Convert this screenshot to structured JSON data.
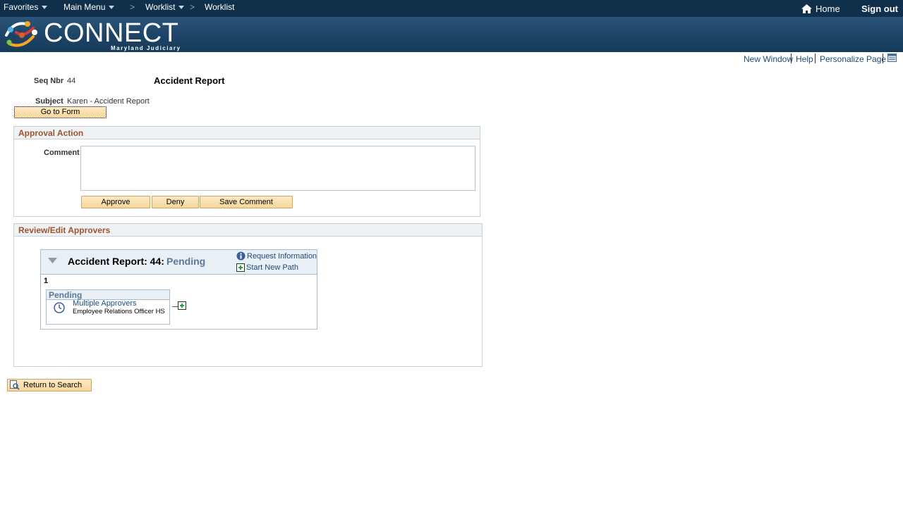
{
  "topnav": {
    "favorites": "Favorites",
    "main_menu": "Main Menu",
    "worklist_menu": "Worklist",
    "worklist_crumb": "Worklist",
    "sep": ">",
    "home": "Home",
    "sign_out": "Sign out"
  },
  "banner": {
    "logo_text": "CONNECT",
    "logo_sub": "Maryland Judiciary"
  },
  "page_links": {
    "new_window": "New Window",
    "help": "Help",
    "personalize": "Personalize Page"
  },
  "record": {
    "seq_label": "Seq Nbr",
    "seq_value": "44",
    "title": "Accident Report",
    "subject_label": "Subject",
    "subject_value": "Karen - Accident Report",
    "go_to_form": "Go to Form"
  },
  "approval": {
    "header": "Approval Action",
    "comment_label": "Comment",
    "comment_value": "",
    "approve": "Approve",
    "deny": "Deny",
    "save_comment": "Save Comment"
  },
  "review": {
    "header": "Review/Edit Approvers",
    "map_title": "Accident Report: 44:",
    "map_status": "Pending",
    "request_info": "Request Information",
    "start_new_path": "Start New Path",
    "step_number": "1",
    "step_status": "Pending",
    "approver_link": "Multiple Approvers",
    "approver_role": "Employee Relations Officer HS"
  },
  "footer": {
    "return_to_search": "Return to Search"
  },
  "colors": {
    "nav_bg": "#0f2f4a",
    "banner_bg": "#1d4466",
    "section_header": "#a0522d",
    "link": "#1c4c7a",
    "button_bg": "#f7d799"
  }
}
